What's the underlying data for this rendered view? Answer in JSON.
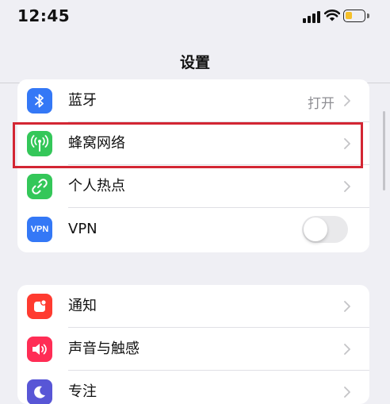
{
  "status_bar": {
    "time": "12:45",
    "battery_level": 0.4,
    "battery_color": "#f5c02b"
  },
  "nav": {
    "title": "设置"
  },
  "groups": [
    {
      "rows": [
        {
          "label": "蓝牙",
          "value": "打开",
          "icon": "bluetooth-icon",
          "icon_color": "#3478f6"
        },
        {
          "label": "蜂窝网络",
          "icon": "cellular-antenna-icon",
          "icon_color": "#34c759",
          "highlighted": true
        },
        {
          "label": "个人热点",
          "icon": "personal-hotspot-icon",
          "icon_color": "#34c759"
        },
        {
          "label": "VPN",
          "icon": "vpn-icon",
          "icon_text": "VPN",
          "icon_color": "#3478f6",
          "toggle_on": false
        }
      ]
    },
    {
      "rows": [
        {
          "label": "通知",
          "icon": "notifications-icon",
          "icon_color": "#ff3b30"
        },
        {
          "label": "声音与触感",
          "icon": "sound-icon",
          "icon_color": "#ff2d55"
        },
        {
          "label": "专注",
          "icon": "focus-moon-icon",
          "icon_color": "#5856d6"
        }
      ]
    }
  ],
  "colors": {
    "highlight_border": "#d32633",
    "background": "#efeff4"
  }
}
